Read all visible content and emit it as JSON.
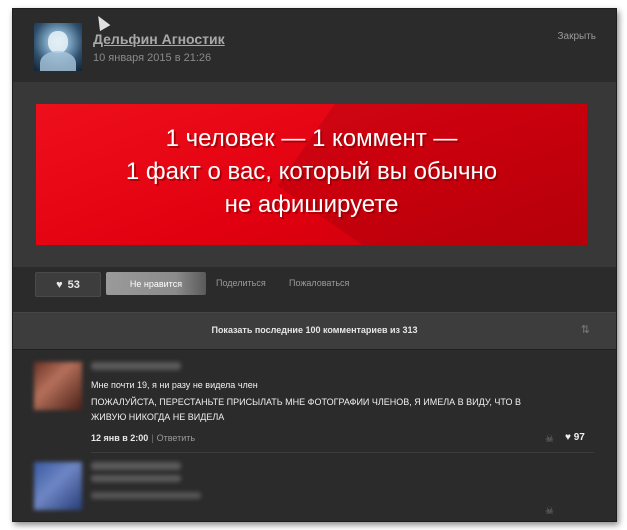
{
  "post": {
    "author": "Дельфин Агностик",
    "date": "10 января 2015 в 21:26",
    "close_label": "Закрыть"
  },
  "banner": {
    "line1": "1 человек — 1 коммент —",
    "line2": "1 факт о вас, который вы обычно",
    "line3": "не афишируете",
    "color": "#e50012"
  },
  "actions": {
    "likes": "53",
    "dislike_label": "Не нравится",
    "share_label": "Поделиться",
    "report_label": "Пожаловаться"
  },
  "comments_bar": {
    "show_more": "Показать последние 100 комментариев из 313"
  },
  "comments": [
    {
      "text1": "Мне почти 19, я ни разу не видела член",
      "text2": "ПОЖАЛУЙСТА, ПЕРЕСТАНЬТЕ ПРИСЫЛАТЬ МНЕ ФОТОГРАФИИ ЧЛЕНОВ, Я ИМЕЛА В ВИДУ, ЧТО В ЖИВУЮ НИКОГДА НЕ ВИДЕЛА",
      "time": "12 янв в 2:00",
      "reply_label": "Ответить",
      "likes": "97"
    }
  ]
}
